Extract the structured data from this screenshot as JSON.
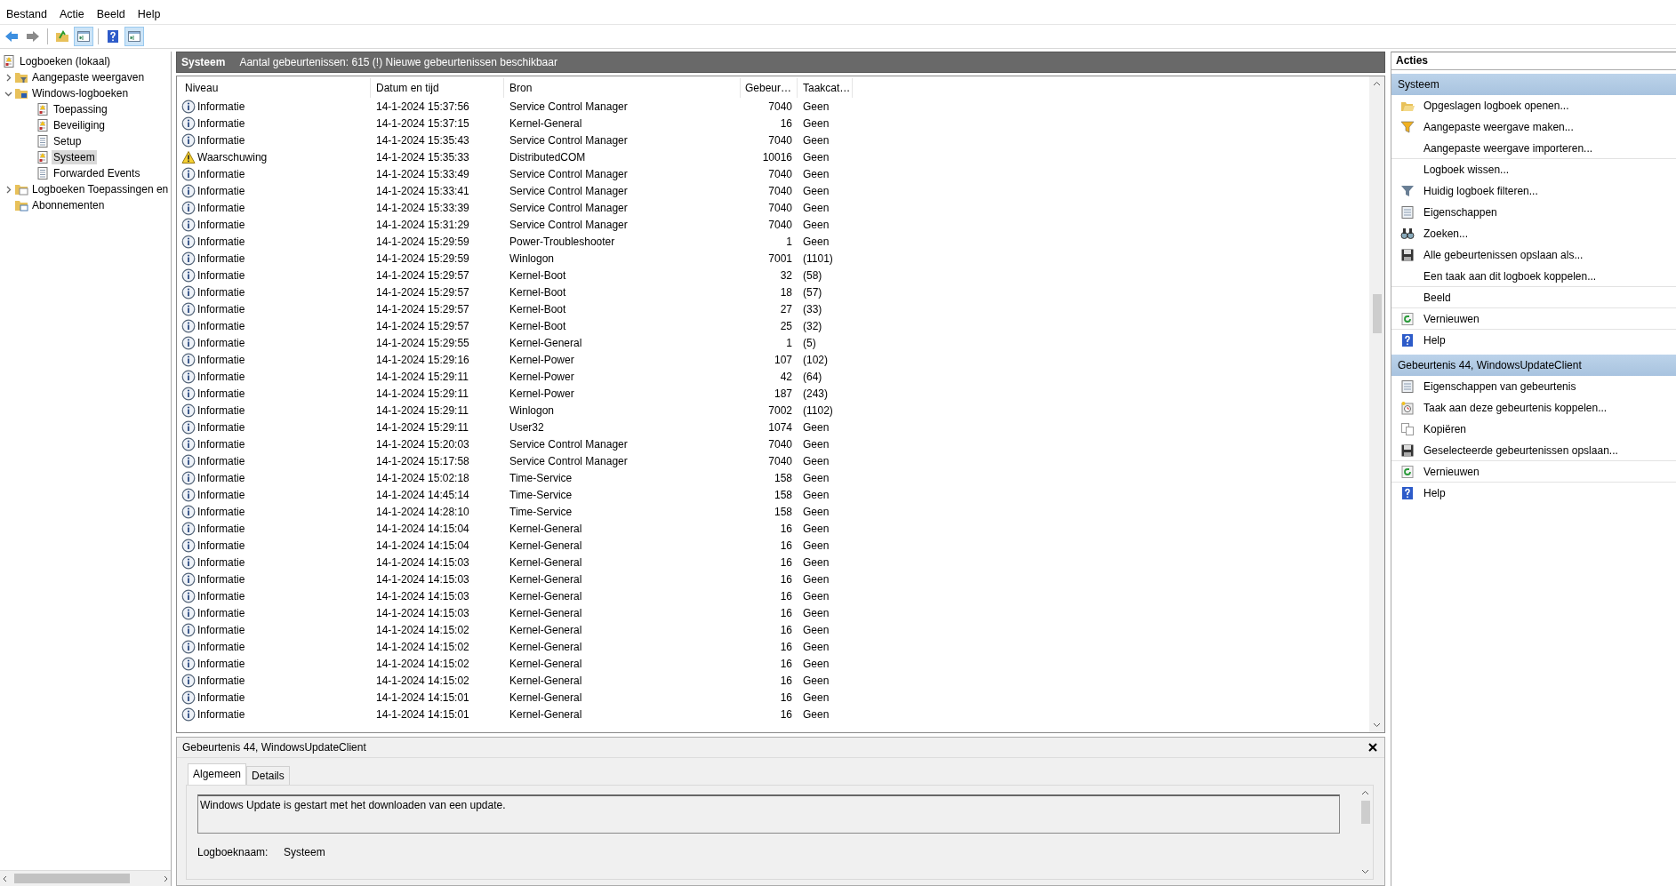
{
  "menu": [
    "Bestand",
    "Actie",
    "Beeld",
    "Help"
  ],
  "toolbar": [
    {
      "kind": "back",
      "pressed": false,
      "separator_before": false
    },
    {
      "kind": "forward",
      "pressed": false,
      "separator_before": false
    },
    {
      "kind": "up-folder",
      "pressed": false,
      "separator_before": true
    },
    {
      "kind": "tree-pane",
      "pressed": true,
      "separator_before": false
    },
    {
      "kind": "help",
      "pressed": false,
      "separator_before": true
    },
    {
      "kind": "action-pane",
      "pressed": true,
      "separator_before": false
    }
  ],
  "tree": [
    {
      "label": "Logboeken (lokaal)",
      "kind": "root",
      "selected": false,
      "children": [
        {
          "label": "Aangepaste weergaven",
          "kind": "filter-folder",
          "selected": false,
          "expanded": false
        },
        {
          "label": "Windows-logboeken",
          "kind": "windows-folder",
          "selected": false,
          "expanded": true,
          "children": [
            {
              "label": "Toepassing",
              "kind": "log",
              "selected": false
            },
            {
              "label": "Beveiliging",
              "kind": "log",
              "selected": false
            },
            {
              "label": "Setup",
              "kind": "plain-log",
              "selected": false
            },
            {
              "label": "Systeem",
              "kind": "log",
              "selected": true
            },
            {
              "label": "Forwarded Events",
              "kind": "plain-log",
              "selected": false
            }
          ]
        },
        {
          "label": "Logboeken Toepassingen en",
          "kind": "folder",
          "selected": false,
          "expanded": false
        },
        {
          "label": "Abonnementen",
          "kind": "subscriptions",
          "selected": false
        }
      ]
    }
  ],
  "header": {
    "title": "Systeem",
    "info": "Aantal gebeurtenissen: 615 (!) Nieuwe gebeurtenissen beschikbaar"
  },
  "table": {
    "columns": [
      "Niveau",
      "Datum en tijd",
      "Bron",
      "Gebeur…",
      "Taakcat…"
    ],
    "rows": [
      {
        "kind": "information",
        "niveau": "Informatie",
        "datum": "14-1-2024 15:37:56",
        "bron": "Service Control Manager",
        "id": "7040",
        "taak": "Geen"
      },
      {
        "kind": "information",
        "niveau": "Informatie",
        "datum": "14-1-2024 15:37:15",
        "bron": "Kernel-General",
        "id": "16",
        "taak": "Geen"
      },
      {
        "kind": "information",
        "niveau": "Informatie",
        "datum": "14-1-2024 15:35:43",
        "bron": "Service Control Manager",
        "id": "7040",
        "taak": "Geen"
      },
      {
        "kind": "warning",
        "niveau": "Waarschuwing",
        "datum": "14-1-2024 15:35:33",
        "bron": "DistributedCOM",
        "id": "10016",
        "taak": "Geen"
      },
      {
        "kind": "information",
        "niveau": "Informatie",
        "datum": "14-1-2024 15:33:49",
        "bron": "Service Control Manager",
        "id": "7040",
        "taak": "Geen"
      },
      {
        "kind": "information",
        "niveau": "Informatie",
        "datum": "14-1-2024 15:33:41",
        "bron": "Service Control Manager",
        "id": "7040",
        "taak": "Geen"
      },
      {
        "kind": "information",
        "niveau": "Informatie",
        "datum": "14-1-2024 15:33:39",
        "bron": "Service Control Manager",
        "id": "7040",
        "taak": "Geen"
      },
      {
        "kind": "information",
        "niveau": "Informatie",
        "datum": "14-1-2024 15:31:29",
        "bron": "Service Control Manager",
        "id": "7040",
        "taak": "Geen"
      },
      {
        "kind": "information",
        "niveau": "Informatie",
        "datum": "14-1-2024 15:29:59",
        "bron": "Power-Troubleshooter",
        "id": "1",
        "taak": "Geen"
      },
      {
        "kind": "information",
        "niveau": "Informatie",
        "datum": "14-1-2024 15:29:59",
        "bron": "Winlogon",
        "id": "7001",
        "taak": "(1101)"
      },
      {
        "kind": "information",
        "niveau": "Informatie",
        "datum": "14-1-2024 15:29:57",
        "bron": "Kernel-Boot",
        "id": "32",
        "taak": "(58)"
      },
      {
        "kind": "information",
        "niveau": "Informatie",
        "datum": "14-1-2024 15:29:57",
        "bron": "Kernel-Boot",
        "id": "18",
        "taak": "(57)"
      },
      {
        "kind": "information",
        "niveau": "Informatie",
        "datum": "14-1-2024 15:29:57",
        "bron": "Kernel-Boot",
        "id": "27",
        "taak": "(33)"
      },
      {
        "kind": "information",
        "niveau": "Informatie",
        "datum": "14-1-2024 15:29:57",
        "bron": "Kernel-Boot",
        "id": "25",
        "taak": "(32)"
      },
      {
        "kind": "information",
        "niveau": "Informatie",
        "datum": "14-1-2024 15:29:55",
        "bron": "Kernel-General",
        "id": "1",
        "taak": "(5)"
      },
      {
        "kind": "information",
        "niveau": "Informatie",
        "datum": "14-1-2024 15:29:16",
        "bron": "Kernel-Power",
        "id": "107",
        "taak": "(102)"
      },
      {
        "kind": "information",
        "niveau": "Informatie",
        "datum": "14-1-2024 15:29:11",
        "bron": "Kernel-Power",
        "id": "42",
        "taak": "(64)"
      },
      {
        "kind": "information",
        "niveau": "Informatie",
        "datum": "14-1-2024 15:29:11",
        "bron": "Kernel-Power",
        "id": "187",
        "taak": "(243)"
      },
      {
        "kind": "information",
        "niveau": "Informatie",
        "datum": "14-1-2024 15:29:11",
        "bron": "Winlogon",
        "id": "7002",
        "taak": "(1102)"
      },
      {
        "kind": "information",
        "niveau": "Informatie",
        "datum": "14-1-2024 15:29:11",
        "bron": "User32",
        "id": "1074",
        "taak": "Geen"
      },
      {
        "kind": "information",
        "niveau": "Informatie",
        "datum": "14-1-2024 15:20:03",
        "bron": "Service Control Manager",
        "id": "7040",
        "taak": "Geen"
      },
      {
        "kind": "information",
        "niveau": "Informatie",
        "datum": "14-1-2024 15:17:58",
        "bron": "Service Control Manager",
        "id": "7040",
        "taak": "Geen"
      },
      {
        "kind": "information",
        "niveau": "Informatie",
        "datum": "14-1-2024 15:02:18",
        "bron": "Time-Service",
        "id": "158",
        "taak": "Geen"
      },
      {
        "kind": "information",
        "niveau": "Informatie",
        "datum": "14-1-2024 14:45:14",
        "bron": "Time-Service",
        "id": "158",
        "taak": "Geen"
      },
      {
        "kind": "information",
        "niveau": "Informatie",
        "datum": "14-1-2024 14:28:10",
        "bron": "Time-Service",
        "id": "158",
        "taak": "Geen"
      },
      {
        "kind": "information",
        "niveau": "Informatie",
        "datum": "14-1-2024 14:15:04",
        "bron": "Kernel-General",
        "id": "16",
        "taak": "Geen"
      },
      {
        "kind": "information",
        "niveau": "Informatie",
        "datum": "14-1-2024 14:15:04",
        "bron": "Kernel-General",
        "id": "16",
        "taak": "Geen"
      },
      {
        "kind": "information",
        "niveau": "Informatie",
        "datum": "14-1-2024 14:15:03",
        "bron": "Kernel-General",
        "id": "16",
        "taak": "Geen"
      },
      {
        "kind": "information",
        "niveau": "Informatie",
        "datum": "14-1-2024 14:15:03",
        "bron": "Kernel-General",
        "id": "16",
        "taak": "Geen"
      },
      {
        "kind": "information",
        "niveau": "Informatie",
        "datum": "14-1-2024 14:15:03",
        "bron": "Kernel-General",
        "id": "16",
        "taak": "Geen"
      },
      {
        "kind": "information",
        "niveau": "Informatie",
        "datum": "14-1-2024 14:15:03",
        "bron": "Kernel-General",
        "id": "16",
        "taak": "Geen"
      },
      {
        "kind": "information",
        "niveau": "Informatie",
        "datum": "14-1-2024 14:15:02",
        "bron": "Kernel-General",
        "id": "16",
        "taak": "Geen"
      },
      {
        "kind": "information",
        "niveau": "Informatie",
        "datum": "14-1-2024 14:15:02",
        "bron": "Kernel-General",
        "id": "16",
        "taak": "Geen"
      },
      {
        "kind": "information",
        "niveau": "Informatie",
        "datum": "14-1-2024 14:15:02",
        "bron": "Kernel-General",
        "id": "16",
        "taak": "Geen"
      },
      {
        "kind": "information",
        "niveau": "Informatie",
        "datum": "14-1-2024 14:15:02",
        "bron": "Kernel-General",
        "id": "16",
        "taak": "Geen"
      },
      {
        "kind": "information",
        "niveau": "Informatie",
        "datum": "14-1-2024 14:15:01",
        "bron": "Kernel-General",
        "id": "16",
        "taak": "Geen"
      },
      {
        "kind": "information",
        "niveau": "Informatie",
        "datum": "14-1-2024 14:15:01",
        "bron": "Kernel-General",
        "id": "16",
        "taak": "Geen"
      }
    ]
  },
  "details": {
    "title": "Gebeurtenis 44, WindowsUpdateClient",
    "tabs": [
      {
        "label": "Algemeen",
        "selected": true
      },
      {
        "label": "Details",
        "selected": false
      }
    ],
    "description": "Windows Update is gestart met het downloaden van een update.",
    "fields": [
      {
        "label": "Logboeknaam:",
        "value": "Systeem"
      }
    ]
  },
  "actions": {
    "title": "Acties",
    "sections": [
      {
        "title": "Systeem",
        "items": [
          {
            "label": "Opgeslagen logboek openen...",
            "kind": "open",
            "separator_after": false
          },
          {
            "label": "Aangepaste weergave maken...",
            "kind": "funnel-color",
            "separator_after": false
          },
          {
            "label": "Aangepaste weergave importeren...",
            "kind": "none",
            "separator_after": true
          },
          {
            "label": "Logboek wissen...",
            "kind": "none",
            "separator_after": false
          },
          {
            "label": "Huidig logboek filteren...",
            "kind": "funnel",
            "separator_after": false
          },
          {
            "label": "Eigenschappen",
            "kind": "properties",
            "separator_after": false
          },
          {
            "label": "Zoeken...",
            "kind": "find",
            "separator_after": false
          },
          {
            "label": "Alle gebeurtenissen opslaan als...",
            "kind": "save",
            "separator_after": false
          },
          {
            "label": "Een taak aan dit logboek koppelen...",
            "kind": "none",
            "separator_after": true
          },
          {
            "label": "Beeld",
            "kind": "none",
            "separator_after": true
          },
          {
            "label": "Vernieuwen",
            "kind": "refresh",
            "separator_after": true
          },
          {
            "label": "Help",
            "kind": "help",
            "separator_after": false
          }
        ]
      },
      {
        "title": "Gebeurtenis 44, WindowsUpdateClient",
        "items": [
          {
            "label": "Eigenschappen van gebeurtenis",
            "kind": "properties",
            "separator_after": false
          },
          {
            "label": "Taak aan deze gebeurtenis koppelen...",
            "kind": "task",
            "separator_after": false
          },
          {
            "label": "Kopiëren",
            "kind": "copy",
            "separator_after": false
          },
          {
            "label": "Geselecteerde gebeurtenissen opslaan...",
            "kind": "save",
            "separator_after": true
          },
          {
            "label": "Vernieuwen",
            "kind": "refresh",
            "separator_after": true
          },
          {
            "label": "Help",
            "kind": "help",
            "separator_after": false
          }
        ]
      }
    ]
  }
}
